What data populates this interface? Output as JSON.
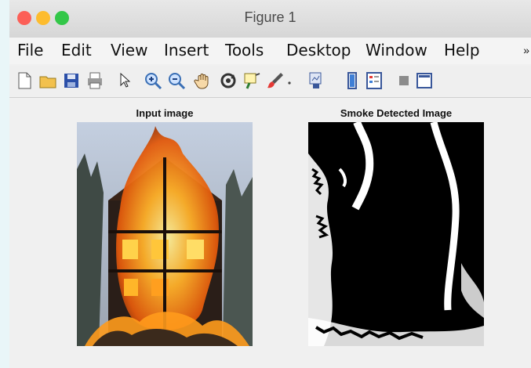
{
  "window": {
    "title": "Figure 1"
  },
  "menu": [
    "File",
    "Edit",
    "View",
    "Insert",
    "Tools",
    "Desktop",
    "Window",
    "Help"
  ],
  "toolbar_icons": [
    "new-file-icon",
    "open-folder-icon",
    "save-icon",
    "print-icon",
    "pointer-icon",
    "zoom-in-icon",
    "zoom-out-icon",
    "pan-hand-icon",
    "rotate-3d-icon",
    "data-cursor-icon",
    "brush-icon",
    "dropdown-arrow-icon",
    "link-plot-icon",
    "colorbar-icon",
    "legend-icon",
    "hide-plot-tools-icon",
    "show-plot-tools-icon"
  ],
  "axes": [
    {
      "title": "Input image"
    },
    {
      "title": "Smoke Detected Image"
    }
  ],
  "colors": {
    "titlebar": "#dcdcdc",
    "close": "#fc5f57",
    "minimize": "#fdbc2e",
    "maximize": "#33c748",
    "figure_bg": "#f0f0f0"
  }
}
